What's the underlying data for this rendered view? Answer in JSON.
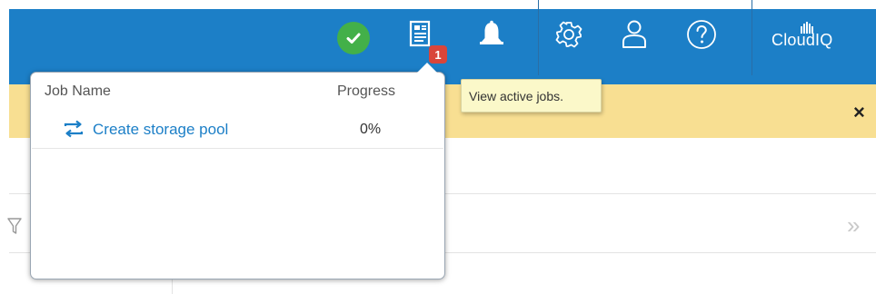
{
  "header": {
    "brand": "CloudIQ",
    "jobs_badge_count": "1",
    "icons": [
      "checkmark-status-icon",
      "jobs-icon",
      "bell-icon",
      "gear-icon",
      "user-icon",
      "help-icon"
    ]
  },
  "tooltip": {
    "text": "View active jobs."
  },
  "banner": {
    "close_label": "×"
  },
  "jobs_popover": {
    "columns": {
      "name": "Job Name",
      "progress": "Progress"
    },
    "rows": [
      {
        "name": "Create storage pool",
        "progress": "0%"
      }
    ]
  },
  "content": {
    "collapse_label": "»"
  },
  "colors": {
    "header_bg": "#1c7fc7",
    "banner_bg": "#f8df92",
    "status_ok": "#43b049",
    "badge": "#d9453a",
    "link": "#1c7fc7",
    "tooltip_bg": "#fbf8c9"
  }
}
